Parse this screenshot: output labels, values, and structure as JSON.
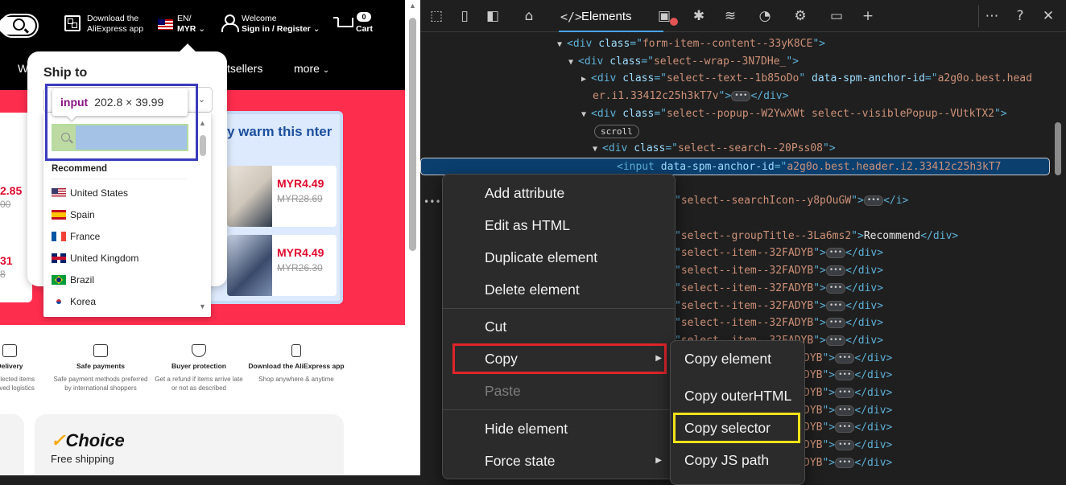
{
  "site": {
    "header": {
      "app_line1": "Download the",
      "app_line2": "AliExpress app",
      "lang": "EN/",
      "currency": "MYR",
      "welcome": "Welcome",
      "signin": "Sign in / Register",
      "cart_count": "0",
      "cart_label": "Cart"
    },
    "nav": {
      "partial_w": "W",
      "bestsellers": "tsellers",
      "more": "more"
    },
    "promo": {
      "title": "y warm this nter",
      "items": [
        {
          "price": "MYR4.49",
          "old": "MYR28.69"
        },
        {
          "price": "MYR4.49",
          "old": "MYR26.30"
        }
      ]
    },
    "left_prices": [
      {
        "price": "2.85",
        "old": "00"
      },
      {
        "price": "31",
        "old": "8"
      }
    ],
    "features": [
      {
        "title": "Delivery",
        "l1": "on selected items",
        "l2": "mproved logistics"
      },
      {
        "title": "Safe payments",
        "l1": "Safe payment methods preferred",
        "l2": "by international shoppers"
      },
      {
        "title": "Buyer protection",
        "l1": "Get a refund if items arrive late",
        "l2": "or not as described"
      },
      {
        "title": "Download the AliExpress app",
        "l1": "Shop anywhere & anytime",
        "l2": ""
      }
    ],
    "choice": {
      "logo": "Choice",
      "sub": "Free shipping"
    },
    "ship_to": {
      "title": "Ship to",
      "group": "Recommend",
      "countries": [
        "United States",
        "Spain",
        "France",
        "United Kingdom",
        "Brazil",
        "Korea"
      ]
    },
    "tooltip": {
      "tag": "input",
      "size": "202.8 × 39.99"
    }
  },
  "devtools": {
    "active_tab": "Elements",
    "code": {
      "l1_cls": "form-item--content--33yK8CE",
      "l2_cls": "select--wrap--3N7DHe_",
      "l3_cls": "select--text--1b85oDo",
      "l3_attr": "data-spm-anchor-id",
      "l3_val": "a2g0o.best.head",
      "l4_val": "er.i1.33412c25h3kT7v",
      "l5_cls": "select--popup--W2YwXWt select--visiblePopup--VUtkTX2",
      "scroll": "scroll",
      "l7_cls": "select--search--20Pss08",
      "l8_attr": "data-spm-anchor-id",
      "l8_val": "a2g0o.best.header.i2.33412c25h3kT7",
      "l9_cls": "select--searchIcon--y8pOuGW",
      "l10_cls": "select--groupTitle--3La6ms2",
      "l10_text": "Recommend",
      "item_cls": "select--item--32FADYB",
      "tail": "DYB"
    },
    "context_menu": {
      "items": [
        "Add attribute",
        "Edit as HTML",
        "Duplicate element",
        "Delete element",
        "Cut",
        "Copy",
        "Paste",
        "Hide element",
        "Force state"
      ]
    },
    "copy_submenu": {
      "items": [
        "Copy element",
        "Copy outerHTML",
        "Copy selector",
        "Copy JS path"
      ]
    }
  },
  "annotation_colors": {
    "inspect_box": "#3a3bbd",
    "copy_highlight": "#e0242b",
    "selector_highlight": "#f2e21a"
  }
}
